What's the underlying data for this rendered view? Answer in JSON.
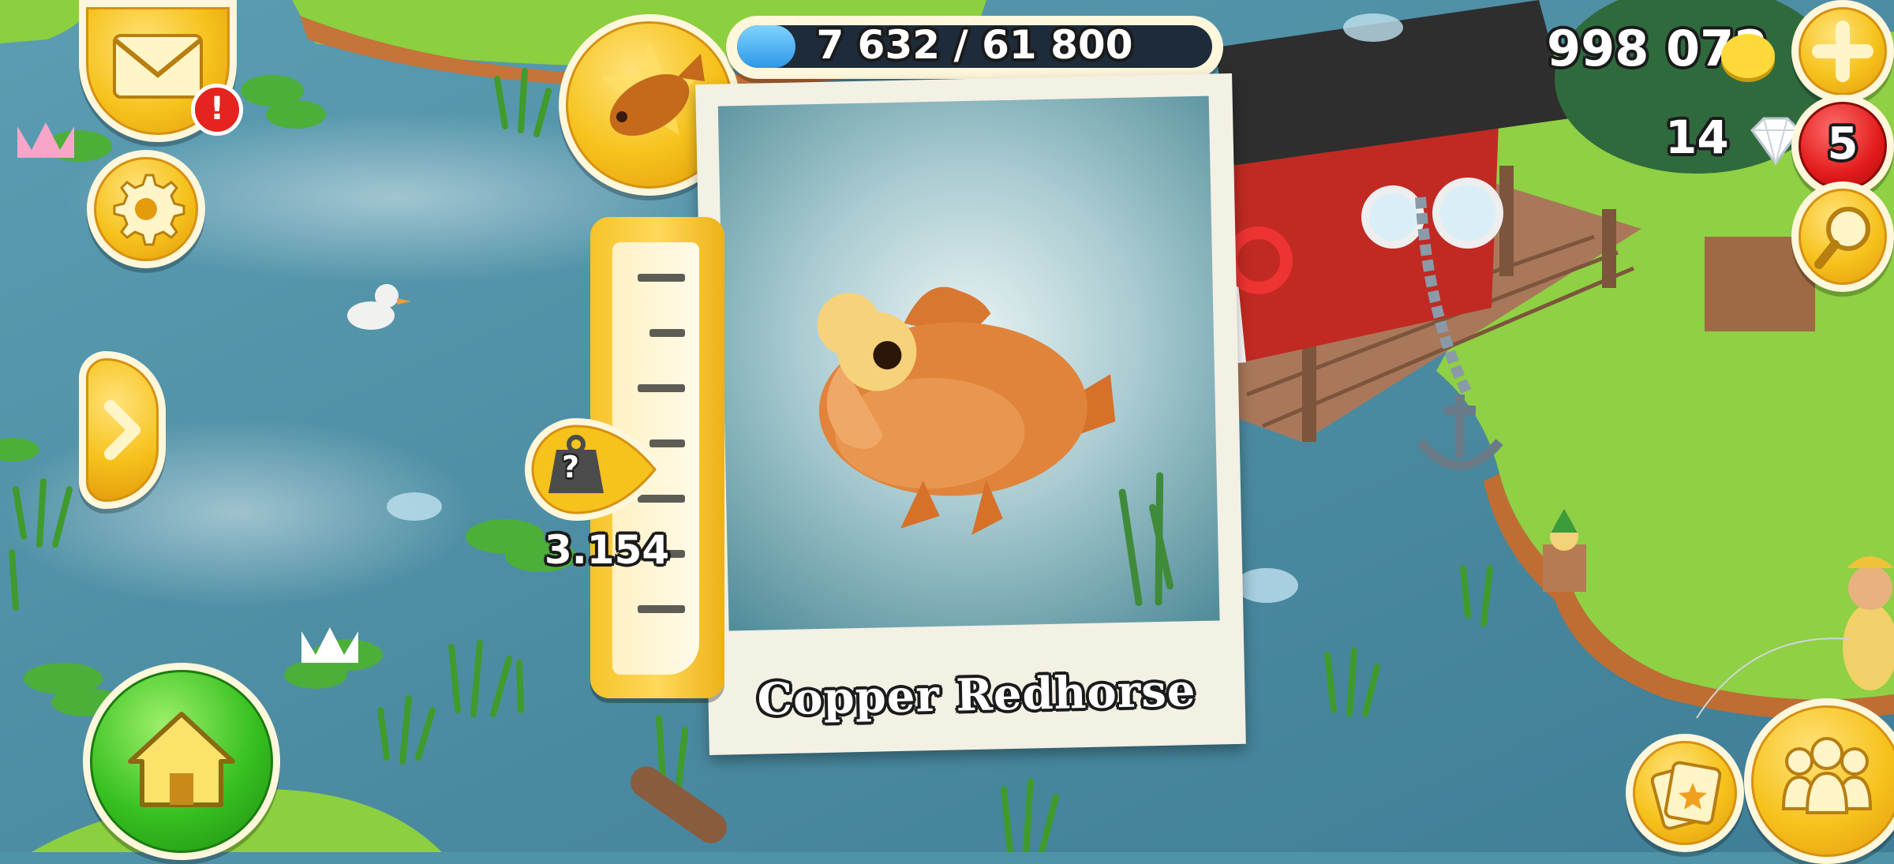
{
  "xp": {
    "label": "7 632 / 61 800",
    "current": 7632,
    "max": 61800
  },
  "currency": {
    "coins": "998 072",
    "diamonds": "14"
  },
  "notifications": {
    "mail_alert": "!",
    "diamond_badge": "5"
  },
  "catch": {
    "fish_name": "Copper Redhorse",
    "weight": "3.154",
    "weight_icon": "?"
  },
  "icons": {
    "mail": "envelope-icon",
    "settings": "gear-icon",
    "expand": "chevron-right-icon",
    "home": "house-icon",
    "trophy": "fish-trophy-icon",
    "coin": "coin-icon",
    "diamond": "diamond-icon",
    "add": "plus-icon",
    "search": "magnifier-icon",
    "cards": "cards-icon",
    "friends": "friends-icon"
  },
  "colors": {
    "button_gold": "#f6c21c",
    "home_green": "#37c020",
    "alert_red": "#e21a1a",
    "water": "#4f93a8",
    "xp_blue": "#2e98e8"
  }
}
